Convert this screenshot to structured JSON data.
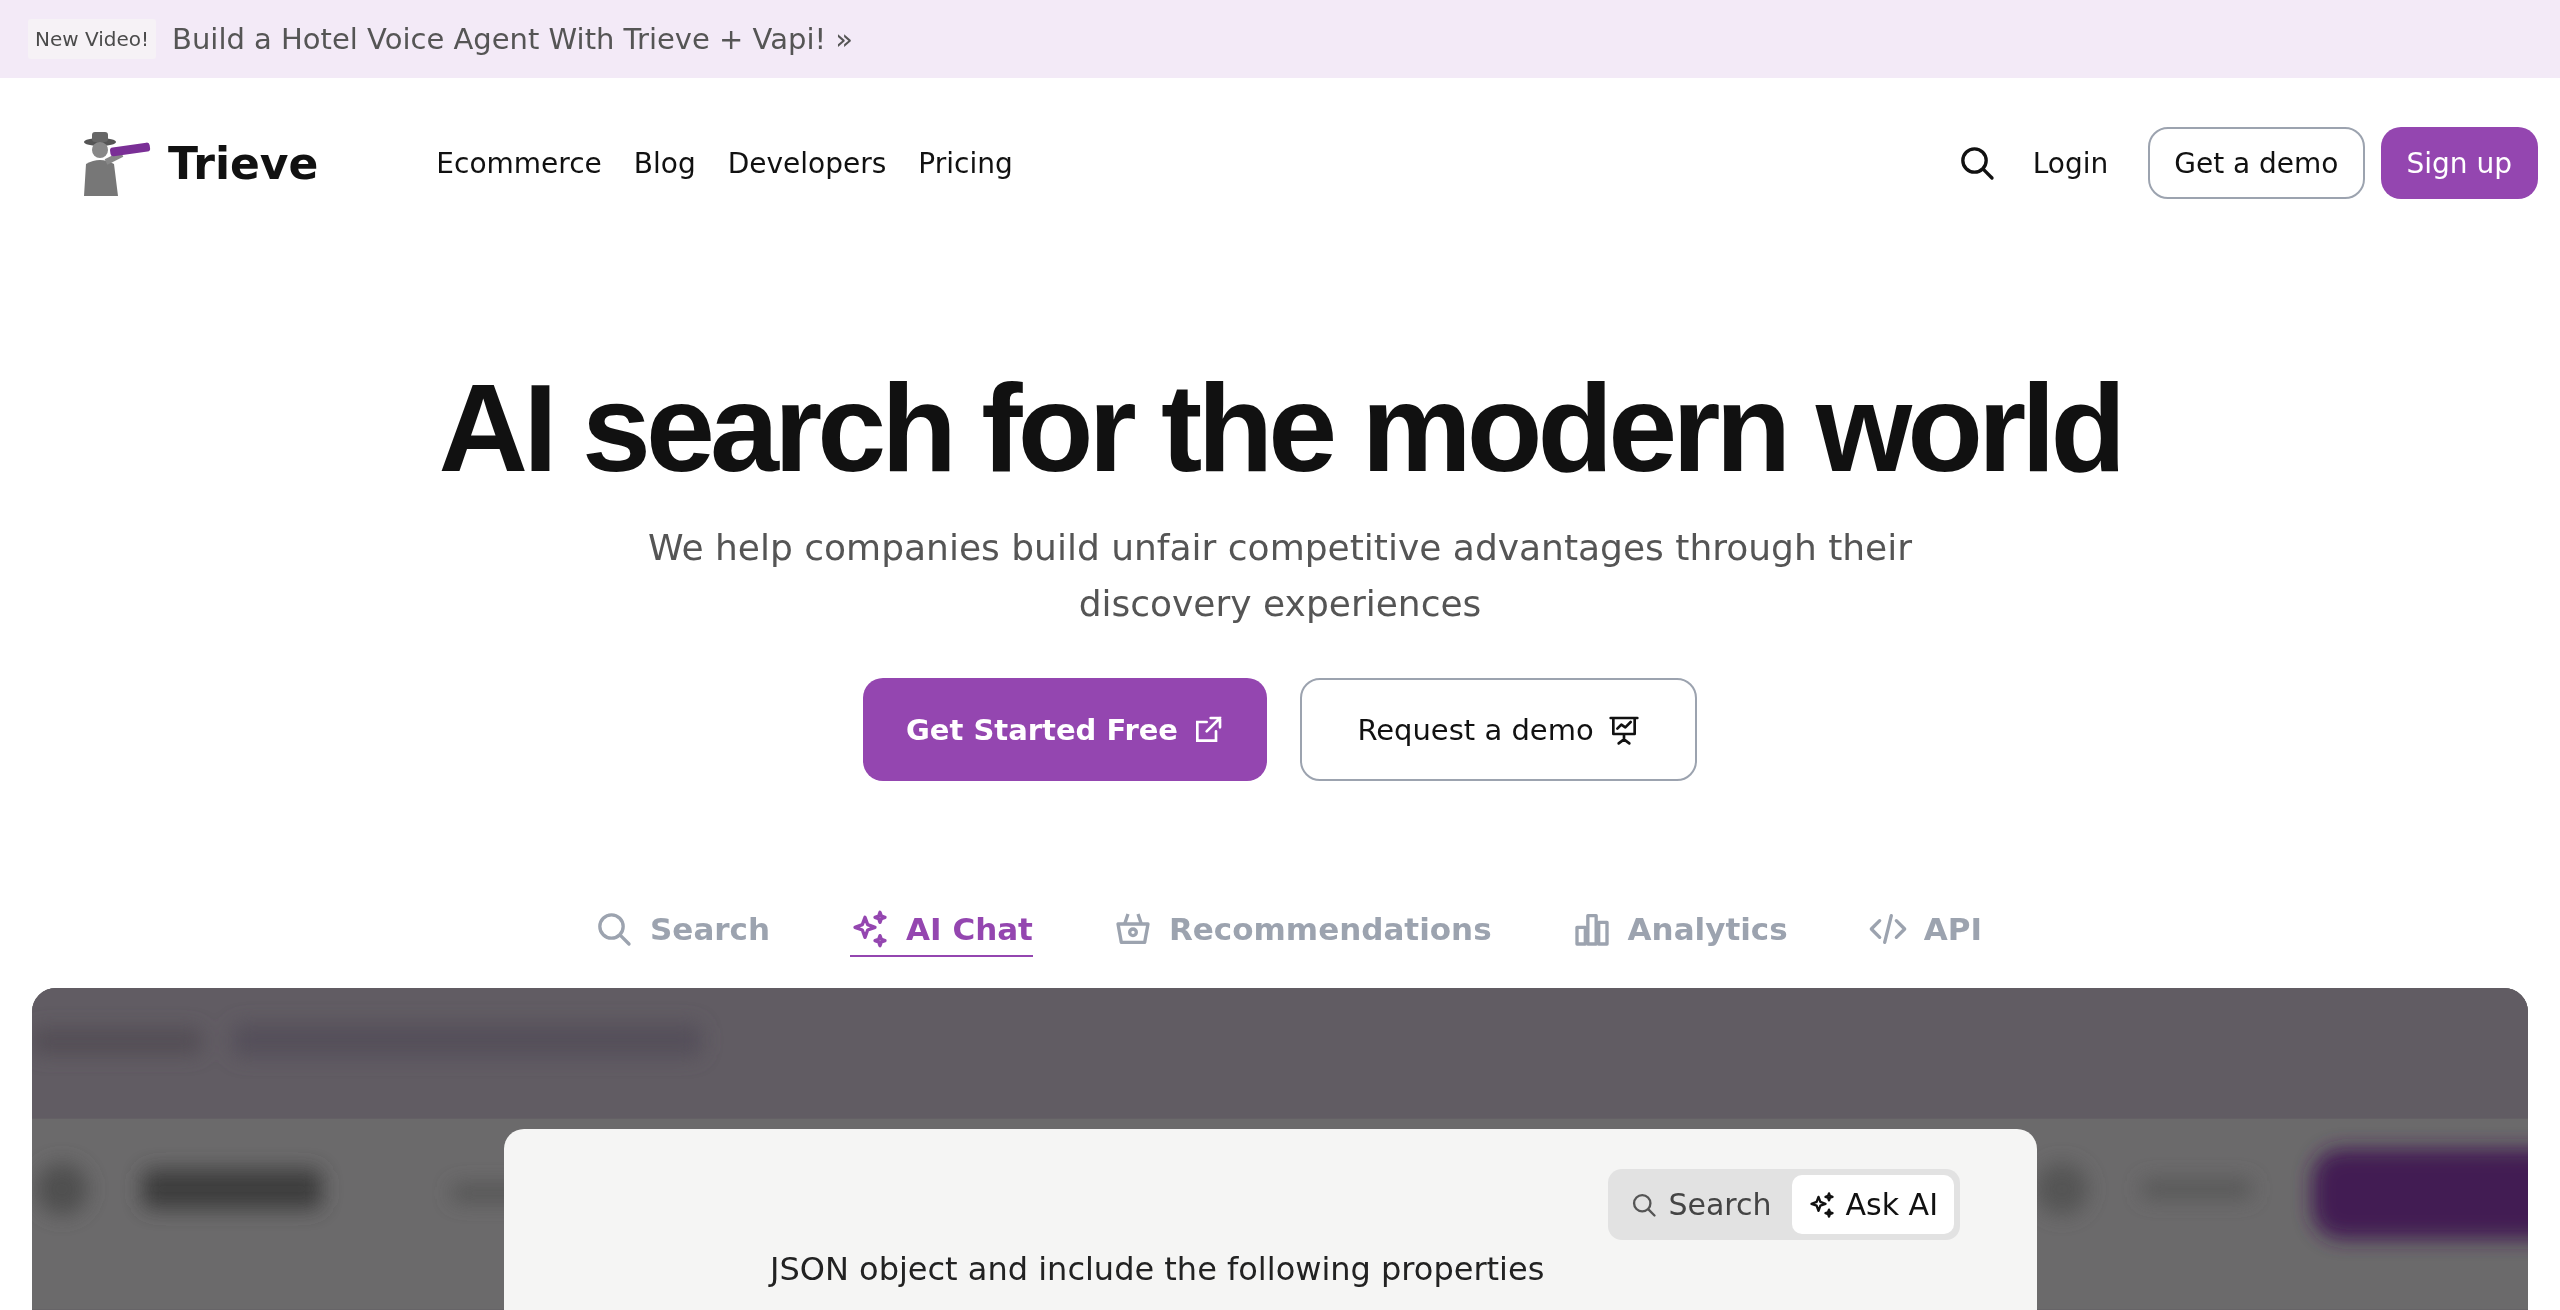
{
  "announcement": {
    "badge": "New Video!",
    "text": "Build a Hotel Voice Agent With Trieve + Vapi! »"
  },
  "nav": {
    "brand": "Trieve",
    "links": [
      "Ecommerce",
      "Blog",
      "Developers",
      "Pricing"
    ],
    "login": "Login",
    "demo_button": "Get a demo",
    "signup_button": "Sign up"
  },
  "hero": {
    "title": "AI search for the modern world",
    "subtitle": "We help companies build unfair competitive advantages through their discovery experiences",
    "primary_button": "Get Started Free",
    "secondary_button": "Request a demo"
  },
  "feature_tabs": [
    {
      "label": "Search",
      "kind": "search",
      "selected": false
    },
    {
      "label": "AI Chat",
      "kind": "sparkle",
      "selected": true
    },
    {
      "label": "Recommendations",
      "kind": "basket",
      "selected": false
    },
    {
      "label": "Analytics",
      "kind": "chart",
      "selected": false
    },
    {
      "label": "API",
      "kind": "code",
      "selected": false
    }
  ],
  "demo": {
    "modes": [
      {
        "label": "Search",
        "kind": "search",
        "selected": false
      },
      {
        "label": "Ask AI",
        "kind": "sparkle",
        "selected": true
      }
    ],
    "text": "JSON object and include the following properties"
  }
}
